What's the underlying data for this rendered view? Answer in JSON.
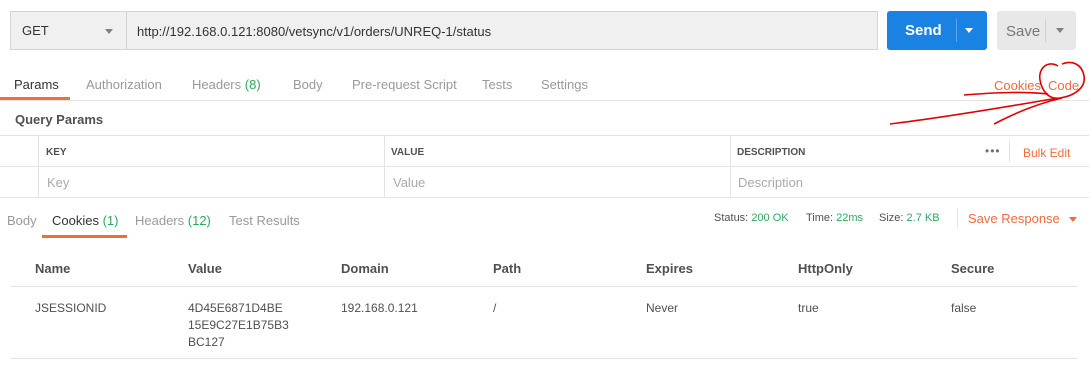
{
  "request": {
    "method": "GET",
    "url": "http://192.168.0.121:8080/vetsync/v1/orders/UNREQ-1/status",
    "send_label": "Send",
    "save_label": "Save"
  },
  "request_tabs": [
    {
      "label": "Params",
      "count": ""
    },
    {
      "label": "Authorization",
      "count": ""
    },
    {
      "label": "Headers",
      "count": "(8)"
    },
    {
      "label": "Body",
      "count": ""
    },
    {
      "label": "Pre-request Script",
      "count": ""
    },
    {
      "label": "Tests",
      "count": ""
    },
    {
      "label": "Settings",
      "count": ""
    }
  ],
  "right_links": {
    "cookies": "Cookies",
    "code": "Code"
  },
  "query_params": {
    "title": "Query Params",
    "columns": [
      "KEY",
      "VALUE",
      "DESCRIPTION"
    ],
    "placeholders": [
      "Key",
      "Value",
      "Description"
    ],
    "more": "•••",
    "bulk_edit": "Bulk Edit"
  },
  "response_tabs": [
    {
      "label": "Body",
      "count": ""
    },
    {
      "label": "Cookies",
      "count": "(1)"
    },
    {
      "label": "Headers",
      "count": "(12)"
    },
    {
      "label": "Test Results",
      "count": ""
    }
  ],
  "response_meta": {
    "status_label": "Status:",
    "status_value": "200 OK",
    "time_label": "Time:",
    "time_value": "22ms",
    "size_label": "Size:",
    "size_value": "2.7 KB",
    "save_response": "Save Response"
  },
  "cookies_table": {
    "columns": [
      "Name",
      "Value",
      "Domain",
      "Path",
      "Expires",
      "HttpOnly",
      "Secure"
    ],
    "rows": [
      {
        "name": "JSESSIONID",
        "value_lines": [
          "4D45E6871D4BE",
          "15E9C27E1B75B3",
          "BC127"
        ],
        "domain": "192.168.0.121",
        "path": "/",
        "expires": "Never",
        "httponly": "true",
        "secure": "false"
      }
    ]
  },
  "colors": {
    "accent": "#f26b3a",
    "send": "#1a82e2",
    "success": "#2eaa60",
    "annotation": "#e00000"
  }
}
